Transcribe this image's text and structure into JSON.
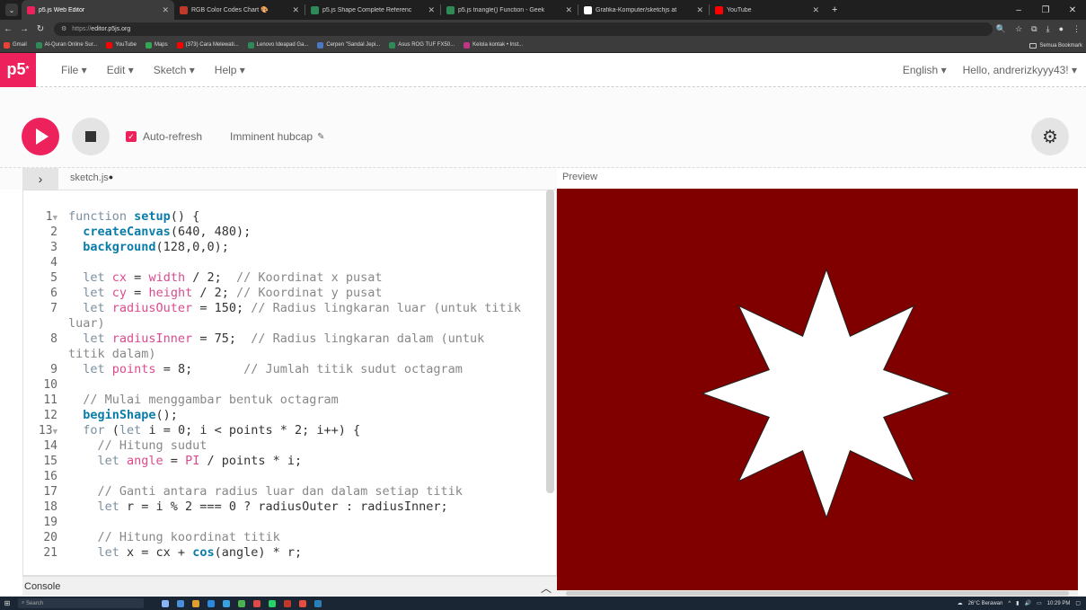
{
  "browser": {
    "tabs": [
      {
        "label": "p5.js Web Editor",
        "fav_color": "#ed225d",
        "active": true
      },
      {
        "label": "RGB Color Codes Chart 🎨",
        "fav_color": "#c0392b",
        "active": false
      },
      {
        "label": "p5.js Shape Complete Referenc",
        "fav_color": "#2e8b57",
        "active": false
      },
      {
        "label": "p5.js triangle() Function - Geek",
        "fav_color": "#2e8b57",
        "active": false
      },
      {
        "label": "Grafika-Komputer/sketchjs at",
        "fav_color": "#ffffff",
        "active": false
      },
      {
        "label": "YouTube",
        "fav_color": "#ff0000",
        "active": false
      }
    ],
    "new_tab": "+",
    "url_prefix": "https://",
    "url_host": "editor.p5js.org",
    "bookmarks": [
      {
        "label": "Gmail",
        "color": "#ea4335"
      },
      {
        "label": "Al-Quran Online Sur...",
        "color": "#2e8b57"
      },
      {
        "label": "YouTube",
        "color": "#ff0000"
      },
      {
        "label": "Maps",
        "color": "#34a853"
      },
      {
        "label": "(373) Cara Melewati...",
        "color": "#ff0000"
      },
      {
        "label": "Lenovo Ideapad Ga...",
        "color": "#2e8b57"
      },
      {
        "label": "Cerpen \"Sandal Jepi...",
        "color": "#4a78c2"
      },
      {
        "label": "Asus ROG TUF FX50...",
        "color": "#2e8b57"
      },
      {
        "label": "Kelola kontak • Inst...",
        "color": "#c13584"
      }
    ],
    "all_bookmarks": "Semua Bookmark"
  },
  "menubar": {
    "logo": "p5",
    "items": [
      "File ▾",
      "Edit ▾",
      "Sketch ▾",
      "Help ▾"
    ],
    "language": "English ▾",
    "user": "Hello, andrerizkyyy43! ▾"
  },
  "toolbar": {
    "auto_refresh_label": "Auto-refresh",
    "auto_refresh_checked": true,
    "project_name": "Imminent hubcap"
  },
  "editor": {
    "filename": "sketch.js",
    "preview_label": "Preview",
    "console_label": "Console"
  },
  "code_lines": [
    {
      "n": "1",
      "fold": true,
      "segs": [
        [
          "kw",
          "function "
        ],
        [
          "fn",
          "setup"
        ],
        [
          "op",
          "() {"
        ]
      ]
    },
    {
      "n": "2",
      "segs": [
        [
          "op",
          "  "
        ],
        [
          "fn",
          "createCanvas"
        ],
        [
          "op",
          "(640, 480);"
        ]
      ]
    },
    {
      "n": "3",
      "segs": [
        [
          "op",
          "  "
        ],
        [
          "fn",
          "background"
        ],
        [
          "op",
          "(128,0,0);"
        ]
      ]
    },
    {
      "n": "4",
      "segs": []
    },
    {
      "n": "5",
      "segs": [
        [
          "op",
          "  "
        ],
        [
          "kw",
          "let "
        ],
        [
          "var",
          "cx"
        ],
        [
          "op",
          " = "
        ],
        [
          "var",
          "width"
        ],
        [
          "op",
          " / 2;  "
        ],
        [
          "cm",
          "// Koordinat x pusat"
        ]
      ]
    },
    {
      "n": "6",
      "segs": [
        [
          "op",
          "  "
        ],
        [
          "kw",
          "let "
        ],
        [
          "var",
          "cy"
        ],
        [
          "op",
          " = "
        ],
        [
          "var",
          "height"
        ],
        [
          "op",
          " / 2; "
        ],
        [
          "cm",
          "// Koordinat y pusat"
        ]
      ]
    },
    {
      "n": "7",
      "segs": [
        [
          "op",
          "  "
        ],
        [
          "kw",
          "let "
        ],
        [
          "var",
          "radiusOuter"
        ],
        [
          "op",
          " = 150; "
        ],
        [
          "cm",
          "// Radius lingkaran luar (untuk titik"
        ]
      ]
    },
    {
      "n": "",
      "segs": [
        [
          "cm",
          "luar)"
        ]
      ],
      "wrap": true
    },
    {
      "n": "8",
      "segs": [
        [
          "op",
          "  "
        ],
        [
          "kw",
          "let "
        ],
        [
          "var",
          "radiusInner"
        ],
        [
          "op",
          " = 75;  "
        ],
        [
          "cm",
          "// Radius lingkaran dalam (untuk"
        ]
      ]
    },
    {
      "n": "",
      "segs": [
        [
          "cm",
          "titik dalam)"
        ]
      ],
      "wrap": true
    },
    {
      "n": "9",
      "segs": [
        [
          "op",
          "  "
        ],
        [
          "kw",
          "let "
        ],
        [
          "var",
          "points"
        ],
        [
          "op",
          " = 8;       "
        ],
        [
          "cm",
          "// Jumlah titik sudut octagram"
        ]
      ]
    },
    {
      "n": "10",
      "segs": []
    },
    {
      "n": "11",
      "segs": [
        [
          "op",
          "  "
        ],
        [
          "cm",
          "// Mulai menggambar bentuk octagram"
        ]
      ]
    },
    {
      "n": "12",
      "segs": [
        [
          "op",
          "  "
        ],
        [
          "fn",
          "beginShape"
        ],
        [
          "op",
          "();"
        ]
      ]
    },
    {
      "n": "13",
      "fold": true,
      "segs": [
        [
          "op",
          "  "
        ],
        [
          "kw",
          "for "
        ],
        [
          "op",
          "("
        ],
        [
          "kw",
          "let "
        ],
        [
          "op",
          "i = 0; i < points * 2; i++) {"
        ]
      ]
    },
    {
      "n": "14",
      "segs": [
        [
          "op",
          "    "
        ],
        [
          "cm",
          "// Hitung sudut"
        ]
      ]
    },
    {
      "n": "15",
      "segs": [
        [
          "op",
          "    "
        ],
        [
          "kw",
          "let "
        ],
        [
          "var",
          "angle"
        ],
        [
          "op",
          " = "
        ],
        [
          "var",
          "PI"
        ],
        [
          "op",
          " / points * i;"
        ]
      ]
    },
    {
      "n": "16",
      "segs": []
    },
    {
      "n": "17",
      "segs": [
        [
          "op",
          "    "
        ],
        [
          "cm",
          "// Ganti antara radius luar dan dalam setiap titik"
        ]
      ]
    },
    {
      "n": "18",
      "segs": [
        [
          "op",
          "    "
        ],
        [
          "kw",
          "let "
        ],
        [
          "op",
          "r = i % 2 === 0 ? radiusOuter : radiusInner;"
        ]
      ]
    },
    {
      "n": "19",
      "segs": []
    },
    {
      "n": "20",
      "segs": [
        [
          "op",
          "    "
        ],
        [
          "cm",
          "// Hitung koordinat titik"
        ]
      ]
    },
    {
      "n": "21",
      "segs": [
        [
          "op",
          "    "
        ],
        [
          "kw",
          "let "
        ],
        [
          "op",
          "x = cx + "
        ],
        [
          "fn",
          "cos"
        ],
        [
          "op",
          "(angle) * r;"
        ]
      ]
    }
  ],
  "sketch": {
    "background": "#800000",
    "fill": "#ffffff",
    "points": 8,
    "radius_outer": 150,
    "radius_inner": 75,
    "canvas_width": 640,
    "canvas_height": 480
  },
  "taskbar": {
    "search": "Search",
    "weather": "26°C  Berawan",
    "time": "10:29 PM"
  },
  "colors": {
    "accent": "#ed225d"
  }
}
